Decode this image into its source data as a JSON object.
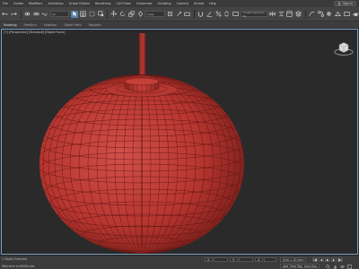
{
  "menubar": {
    "items": [
      "File",
      "Create",
      "Modifiers",
      "Animation",
      "Graph Editors",
      "Rendering",
      "Civil View",
      "Customize",
      "Scripting",
      "Content",
      "Arnold",
      "Help"
    ],
    "signin": "Sign In"
  },
  "toolbar": {
    "dropdown": "All",
    "view_dropdown": "View",
    "selection_set_placeholder": "Create Selection Se"
  },
  "ribbon": {
    "tabs": [
      "Modeling",
      "Freeform",
      "Selection",
      "Object Paint",
      "Populate"
    ]
  },
  "viewport": {
    "label": "[+] [Perspective] [Standard] [Edged Faces]"
  },
  "status": {
    "top_text": "1 Object Selected",
    "left_text": "Welcome to MAXScript.",
    "x_label": "X:",
    "y_label": "Y:",
    "z_label": "Z:",
    "x_value": "",
    "y_value": "",
    "z_value": "",
    "grid": "Grid = 10.0cm",
    "add_time_tag": "Add Time Tag",
    "auto_key": "Auto Key",
    "set_key": "Set Key"
  },
  "colors": {
    "model": "#c23a32",
    "accent": "#5a7fa6",
    "viewport_border": "#7aa0c8"
  }
}
